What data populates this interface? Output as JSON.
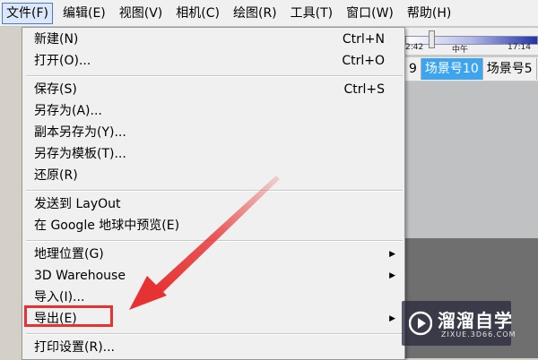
{
  "menubar": {
    "items": [
      {
        "label": "文件(F)"
      },
      {
        "label": "编辑(E)"
      },
      {
        "label": "视图(V)"
      },
      {
        "label": "相机(C)"
      },
      {
        "label": "绘图(R)"
      },
      {
        "label": "工具(T)"
      },
      {
        "label": "窗口(W)"
      },
      {
        "label": "帮助(H)"
      }
    ]
  },
  "shadow_slider": {
    "start": "2:42",
    "middle": "中午",
    "end": "17:14",
    "position_fraction": 0.18
  },
  "scene_tabs": [
    "9",
    "场景号10",
    "场景号5"
  ],
  "file_menu": {
    "new_label": "新建(N)",
    "new_shortcut": "Ctrl+N",
    "open_label": "打开(O)...",
    "open_shortcut": "Ctrl+O",
    "save_label": "保存(S)",
    "save_shortcut": "Ctrl+S",
    "save_as_label": "另存为(A)...",
    "save_copy_label": "副本另存为(Y)...",
    "save_template_label": "另存为模板(T)...",
    "revert_label": "还原(R)",
    "send_layout_label": "发送到 LayOut",
    "google_earth_label": "在 Google 地球中预览(E)",
    "geo_label": "地理位置(G)",
    "warehouse_label": "3D Warehouse",
    "import_label": "导入(I)...",
    "export_label": "导出(E)",
    "print_setup_label": "打印设置(R)..."
  },
  "watermark": {
    "title": "溜溜自学",
    "subtitle": "ZIXUE.3D66.COM"
  },
  "colors": {
    "highlight": "#e63232",
    "active_tab": "#3da4ef"
  }
}
